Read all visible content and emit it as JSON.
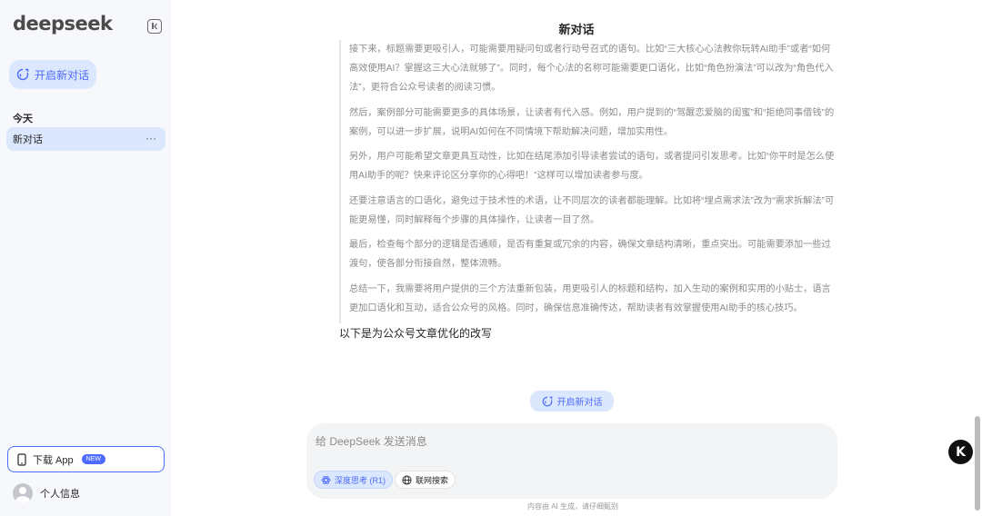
{
  "sidebar": {
    "logo": "deepseek",
    "new_chat_label": "开启新对话",
    "section_today": "今天",
    "chat_items": [
      {
        "label": "新对话",
        "more": "···"
      }
    ],
    "download_label": "下载 App",
    "download_badge": "NEW",
    "profile_label": "个人信息"
  },
  "main": {
    "title": "新对话",
    "thinking_paragraphs": [
      "接下来，标题需要更吸引人，可能需要用疑问句或者行动号召式的语句。比如“三大核心心法教你玩转AI助手”或者“如何高效使用AI？掌握这三大心法就够了”。同时，每个心法的名称可能需要更口语化，比如“角色扮演法”可以改为“角色代入法”，更符合公众号读者的阅读习惯。",
      "然后，案例部分可能需要更多的具体场景，让读者有代入感。例如，用户提到的“驾醒恋爱脑的闺蜜”和“拒绝同事借钱”的案例，可以进一步扩展，说明AI如何在不同情境下帮助解决问题，增加实用性。",
      "另外，用户可能希望文章更具互动性，比如在结尾添加引导读者尝试的语句，或者提问引发思考。比如“你平时是怎么使用AI助手的呢？快来评论区分享你的心得吧！”这样可以增加读者参与度。",
      "还要注意语言的口语化，避免过于技术性的术语，让不同层次的读者都能理解。比如将“埋点需求法”改为“需求拆解法”可能更易懂，同时解释每个步骤的具体操作，让读者一目了然。",
      "最后，检查每个部分的逻辑是否通顺，是否有重复或冗余的内容，确保文章结构清晰，重点突出。可能需要添加一些过渡句，使各部分衔接自然，整体流畅。",
      "总结一下，我需要将用户提供的三个方法重新包装，用更吸引人的标题和结构，加入生动的案例和实用的小贴士，语言更加口语化和互动，适合公众号的风格。同时，确保信息准确传达，帮助读者有效掌握使用AI助手的核心技巧。"
    ],
    "answer_heading": "以下是为公众号文章优化的改写",
    "floating_new_chat": "开启新对话"
  },
  "composer": {
    "placeholder": "给 DeepSeek 发送消息",
    "deep_think_label": "深度思考 (R1)",
    "web_search_label": "联网搜索"
  },
  "footer_note": "内容由 AI 生成，请仔细甄别",
  "floating_badge": "K",
  "colors": {
    "accent": "#4d6bfe",
    "accent_bg": "#dbe7fd",
    "sidebar_bg": "#f6f8fb"
  }
}
